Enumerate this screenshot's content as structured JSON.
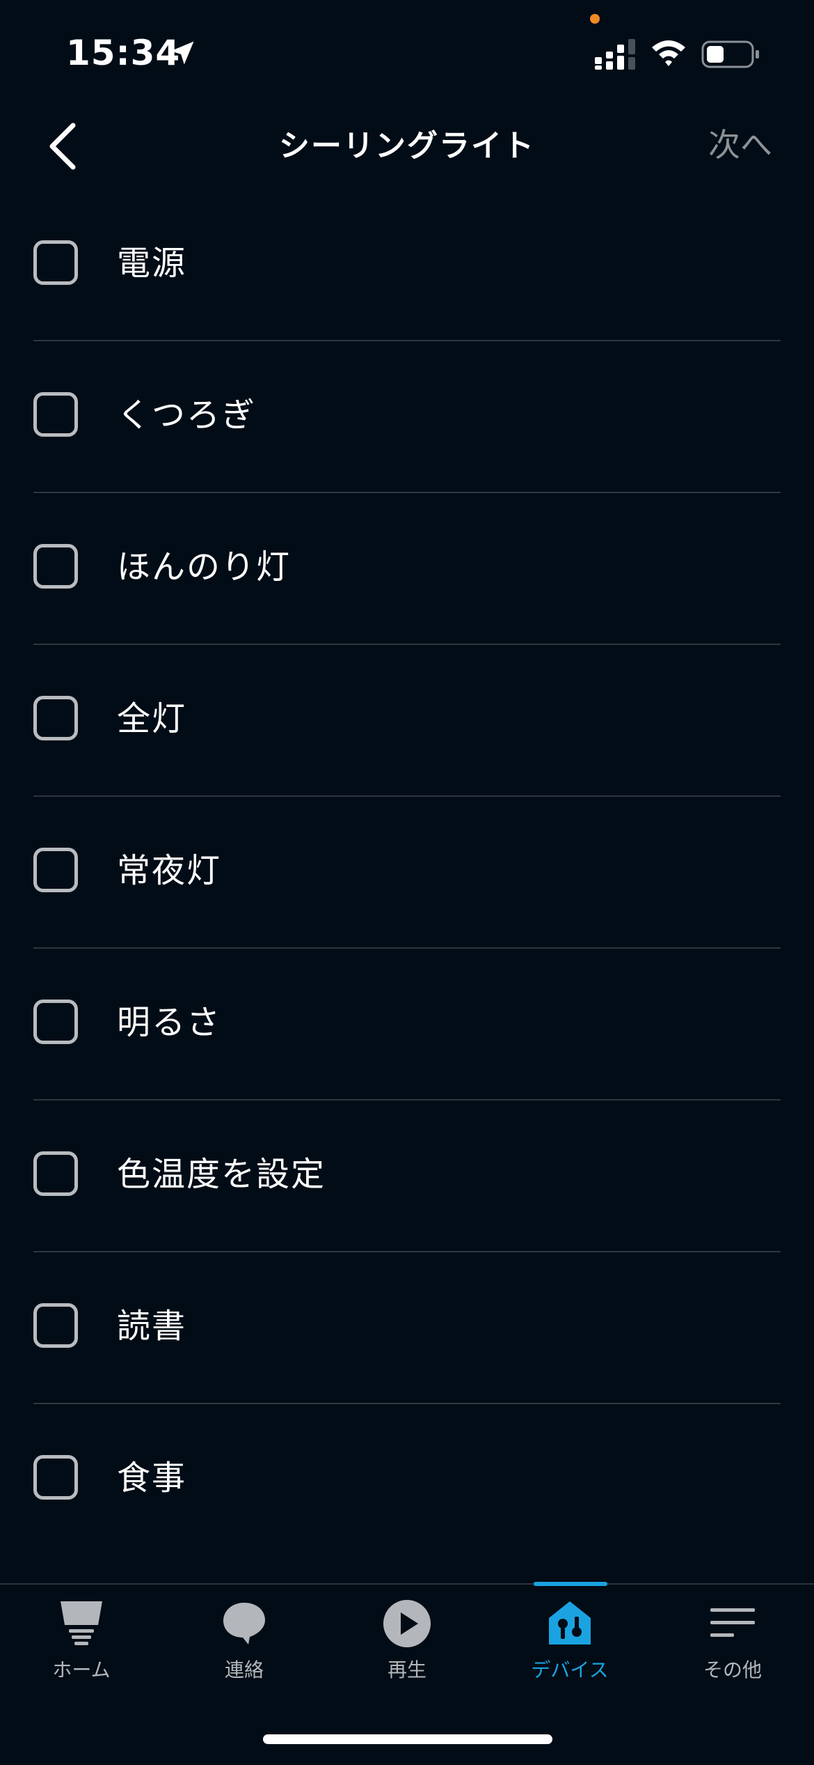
{
  "status_bar": {
    "time": "15:34"
  },
  "header": {
    "title": "シーリングライト",
    "next_label": "次へ"
  },
  "items": [
    {
      "label": "電源",
      "checked": false
    },
    {
      "label": "くつろぎ",
      "checked": false
    },
    {
      "label": "ほんのり灯",
      "checked": false
    },
    {
      "label": "全灯",
      "checked": false
    },
    {
      "label": "常夜灯",
      "checked": false
    },
    {
      "label": "明るさ",
      "checked": false
    },
    {
      "label": "色温度を設定",
      "checked": false
    },
    {
      "label": "読書",
      "checked": false
    },
    {
      "label": "食事",
      "checked": false
    }
  ],
  "tabs": [
    {
      "label": "ホーム",
      "icon": "home-icon",
      "active": false
    },
    {
      "label": "連絡",
      "icon": "chat-bubble-icon",
      "active": false
    },
    {
      "label": "再生",
      "icon": "play-icon",
      "active": false
    },
    {
      "label": "デバイス",
      "icon": "devices-house-icon",
      "active": true
    },
    {
      "label": "その他",
      "icon": "menu-lines-icon",
      "active": false
    }
  ],
  "colors": {
    "background": "#020c16",
    "accent": "#1aa3e0",
    "inactive_text": "#b3b7bb",
    "next_text": "#8c9196",
    "privacy_dot": "#f08a24"
  }
}
